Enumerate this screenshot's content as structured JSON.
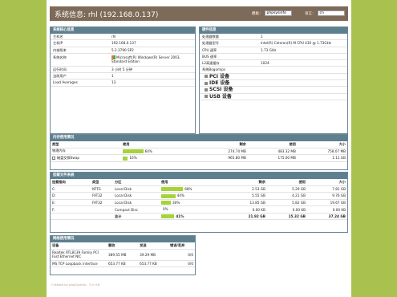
{
  "header": {
    "title": "系统信息: rhl (192.168.0.137)",
    "template_label": "模板：",
    "template_value": "phpsysinfo",
    "language_label": "语言：",
    "language_value": "cn"
  },
  "vitals": {
    "title": "系统核心信息",
    "rows": [
      {
        "k": "主机名",
        "v": "rhl"
      },
      {
        "k": "主机IP",
        "v": "192.168.0.137"
      },
      {
        "k": "内核版本",
        "v": "5.2.3790 SP2"
      },
      {
        "k": "系统名称",
        "v": "Microsoft(R) Windows(R) Server 2003, Standard Edition"
      },
      {
        "k": "运行时间",
        "v": "3 小时 5 分钟"
      },
      {
        "k": "当前用户",
        "v": "1"
      },
      {
        "k": "Load Averages",
        "v": "13"
      }
    ]
  },
  "hardware": {
    "title": "硬件信息",
    "rows": [
      {
        "k": "处理器数量",
        "v": "1"
      },
      {
        "k": "处理器型号",
        "v": "Intel(R) Celeron(R) M CPU 430 @ 1.73GHz"
      },
      {
        "k": "CPU 速率",
        "v": "1.73 GHz"
      },
      {
        "k": "BUS 速率",
        "v": ""
      },
      {
        "k": "L2高速缓存",
        "v": "1024"
      },
      {
        "k": "系统Bogomips",
        "v": ""
      }
    ],
    "devices": [
      "PCI 设备",
      "IDE 设备",
      "SCSI 设备",
      "USB 设备"
    ]
  },
  "memory": {
    "title": "内存使用情况",
    "headers": [
      "类型",
      "使用",
      "剩余",
      "使用",
      "大小"
    ],
    "rows": [
      {
        "type": "物理内存",
        "pct": 64,
        "pct_label": "64%",
        "free": "274.74 MB",
        "used": "483.32 MB",
        "size": "758.07 MB"
      },
      {
        "type": "磁盘交换Swap",
        "pct": 16,
        "pct_label": "16%",
        "free": "965.80 MB",
        "used": "175.00 MB",
        "size": "1.11 GB"
      }
    ]
  },
  "filesystems": {
    "title": "挂载文件系统",
    "headers": [
      "挂载指向",
      "类型",
      "分区",
      "使用",
      "剩余",
      "使用",
      "大小"
    ],
    "rows": [
      {
        "mount": "C:",
        "type": "NTFS",
        "part": "Local Disk",
        "pct": 68,
        "pct_label": "68%",
        "free": "2.53 GB",
        "used": "5.29 GB",
        "size": "7.81 GB"
      },
      {
        "mount": "D:",
        "type": "FAT32",
        "part": "Local Disk",
        "pct": 44,
        "pct_label": "44%",
        "free": "5.55 GB",
        "used": "4.21 GB",
        "size": "9.76 GB"
      },
      {
        "mount": "E:",
        "type": "FAT32",
        "part": "Local Disk",
        "pct": 30,
        "pct_label": "30%",
        "free": "13.85 GB",
        "used": "5.82 GB",
        "size": "19.67 GB"
      },
      {
        "mount": "F:",
        "type": "",
        "part": "Compact Disc",
        "pct": 0,
        "pct_label": "0%",
        "free": "0.00 KB",
        "used": "0.00 KB",
        "size": "0.00 KB"
      }
    ],
    "total": {
      "label": "总计",
      "pct": 41,
      "pct_label": "41%",
      "free": "21.92 GB",
      "used": "15.32 GB",
      "size": "37.24 GB"
    }
  },
  "network": {
    "title": "网络使用情况",
    "headers": [
      "设备",
      "载收",
      "发送",
      "错误/丢弃"
    ],
    "rows": [
      {
        "dev": "Realtek RTL8139 Family PCI Fast Ethernet NIC",
        "rx": "389.55 MB",
        "tx": "39.29 MB",
        "err": "0/0"
      },
      {
        "dev": "MS TCP Loopback interface",
        "rx": "653.77 KB",
        "tx": "653.77 KB",
        "err": "0/0"
      }
    ]
  },
  "footer": {
    "text": "Created by phpSysInfo - 3.0 rc6"
  },
  "colors": {
    "background": "#a9c14e",
    "header": "#7d6a58",
    "panel_title": "#5d7f8e",
    "bar": "#a6d33b"
  }
}
